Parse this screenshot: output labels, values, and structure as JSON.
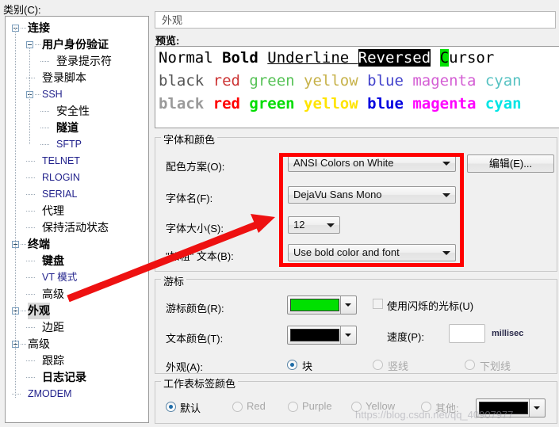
{
  "window": {
    "category_label": "类别(C):",
    "pane_title": "外观",
    "preview_label": "预览:"
  },
  "tree": {
    "items": [
      {
        "label": "连接",
        "depth": 0,
        "toggle": "minus",
        "bold": true,
        "script": "zh"
      },
      {
        "label": "用户身份验证",
        "depth": 1,
        "toggle": "minus",
        "bold": true,
        "script": "zh"
      },
      {
        "label": "登录提示符",
        "depth": 2,
        "toggle": "none",
        "bold": false,
        "script": "zh"
      },
      {
        "label": "登录脚本",
        "depth": 1,
        "toggle": "none",
        "bold": false,
        "script": "zh"
      },
      {
        "label": "SSH",
        "depth": 1,
        "toggle": "minus",
        "bold": false,
        "script": "en"
      },
      {
        "label": "安全性",
        "depth": 2,
        "toggle": "none",
        "bold": false,
        "script": "zh"
      },
      {
        "label": "隧道",
        "depth": 2,
        "toggle": "none",
        "bold": true,
        "script": "zh"
      },
      {
        "label": "SFTP",
        "depth": 2,
        "toggle": "none",
        "bold": false,
        "script": "en"
      },
      {
        "label": "TELNET",
        "depth": 1,
        "toggle": "none",
        "bold": false,
        "script": "en"
      },
      {
        "label": "RLOGIN",
        "depth": 1,
        "toggle": "none",
        "bold": false,
        "script": "en"
      },
      {
        "label": "SERIAL",
        "depth": 1,
        "toggle": "none",
        "bold": false,
        "script": "en"
      },
      {
        "label": "代理",
        "depth": 1,
        "toggle": "none",
        "bold": false,
        "script": "zh"
      },
      {
        "label": "保持活动状态",
        "depth": 1,
        "toggle": "none",
        "bold": false,
        "script": "zh"
      },
      {
        "label": "终端",
        "depth": 0,
        "toggle": "minus",
        "bold": true,
        "script": "zh"
      },
      {
        "label": "键盘",
        "depth": 1,
        "toggle": "none",
        "bold": true,
        "script": "zh"
      },
      {
        "label": "VT 模式",
        "depth": 1,
        "toggle": "none",
        "bold": false,
        "script": "en"
      },
      {
        "label": "高级",
        "depth": 1,
        "toggle": "none",
        "bold": false,
        "script": "zh"
      },
      {
        "label": "外观",
        "depth": 0,
        "toggle": "minus",
        "bold": true,
        "script": "zh",
        "selected": true
      },
      {
        "label": "边距",
        "depth": 1,
        "toggle": "none",
        "bold": false,
        "script": "zh"
      },
      {
        "label": "高级",
        "depth": 0,
        "toggle": "minus",
        "bold": false,
        "script": "zh"
      },
      {
        "label": "跟踪",
        "depth": 1,
        "toggle": "none",
        "bold": false,
        "script": "zh"
      },
      {
        "label": "日志记录",
        "depth": 1,
        "toggle": "none",
        "bold": true,
        "script": "zh"
      },
      {
        "label": "ZMODEM",
        "depth": 0,
        "toggle": "none",
        "bold": false,
        "script": "en"
      }
    ]
  },
  "preview": {
    "row1": [
      {
        "text": "Normal ",
        "style": "normal",
        "color": "#000000"
      },
      {
        "text": "Bold ",
        "style": "bold",
        "color": "#000000"
      },
      {
        "text": "Underline ",
        "style": "underline",
        "color": "#000000"
      },
      {
        "text": "Reversed",
        "style": "reversed",
        "color": "#ffffff"
      },
      {
        "text": " ",
        "style": "normal",
        "color": "#000000"
      },
      {
        "text": "C",
        "style": "cursor",
        "color": "#000000"
      },
      {
        "text": "ursor",
        "style": "normal",
        "color": "#000000"
      }
    ],
    "row2": [
      {
        "text": "black ",
        "color": "#555555"
      },
      {
        "text": "red ",
        "color": "#cc3333"
      },
      {
        "text": "green ",
        "color": "#57c257"
      },
      {
        "text": "yellow ",
        "color": "#c7b24a"
      },
      {
        "text": "blue ",
        "color": "#4444cc"
      },
      {
        "text": "magenta ",
        "color": "#d45fd4"
      },
      {
        "text": "cyan",
        "color": "#57c2c2"
      }
    ],
    "row3": [
      {
        "text": "black ",
        "color": "#9a9a9a"
      },
      {
        "text": "red ",
        "color": "#ff0000"
      },
      {
        "text": "green ",
        "color": "#00dd00"
      },
      {
        "text": "yellow ",
        "color": "#ffe400"
      },
      {
        "text": "blue ",
        "color": "#0000e0"
      },
      {
        "text": "magenta ",
        "color": "#ff00ff"
      },
      {
        "text": "cyan",
        "color": "#00e5e5"
      }
    ],
    "cursor_bg": "#00e000",
    "reversed_bg": "#000000"
  },
  "font_group": {
    "legend": "字体和颜色",
    "scheme_label": "配色方案(O):",
    "scheme_value": "ANSI Colors on White",
    "edit_button": "编辑(E)...",
    "fontname_label": "字体名(F):",
    "fontname_value": "DejaVu Sans Mono",
    "fontsize_label": "字体大小(S):",
    "fontsize_value": "12",
    "bold_label": "\"加粗\" 文本(B):",
    "bold_value": "Use bold color and font"
  },
  "cursor_group": {
    "legend": "游标",
    "cursor_color_label": "游标颜色(R):",
    "cursor_color_value": "#00e000",
    "text_color_label": "文本颜色(T):",
    "text_color_value": "#000000",
    "blink_label": "使用闪烁的光标(U)",
    "blink_checked": false,
    "speed_label": "速度(P):",
    "speed_value": "",
    "speed_unit": "millisec",
    "appearance_label": "外观(A):",
    "appearance_options": [
      {
        "label": "块",
        "selected": true,
        "enabled": true
      },
      {
        "label": "竖线",
        "selected": false,
        "enabled": false
      },
      {
        "label": "下划线",
        "selected": false,
        "enabled": false
      }
    ]
  },
  "tab_group": {
    "legend": "工作表标签颜色",
    "options": [
      {
        "label": "默认",
        "selected": true,
        "enabled": true
      },
      {
        "label": "Red",
        "selected": false,
        "enabled": false
      },
      {
        "label": "Purple",
        "selected": false,
        "enabled": false
      },
      {
        "label": "Yellow",
        "selected": false,
        "enabled": false
      },
      {
        "label": "其他:",
        "selected": false,
        "enabled": false
      }
    ],
    "other_color_value": "#000000"
  },
  "annotation": {
    "highlight_color": "#ff0000",
    "arrow_color": "#ee1111"
  },
  "watermark": "https://blog.csdn.net/qq_40907977"
}
